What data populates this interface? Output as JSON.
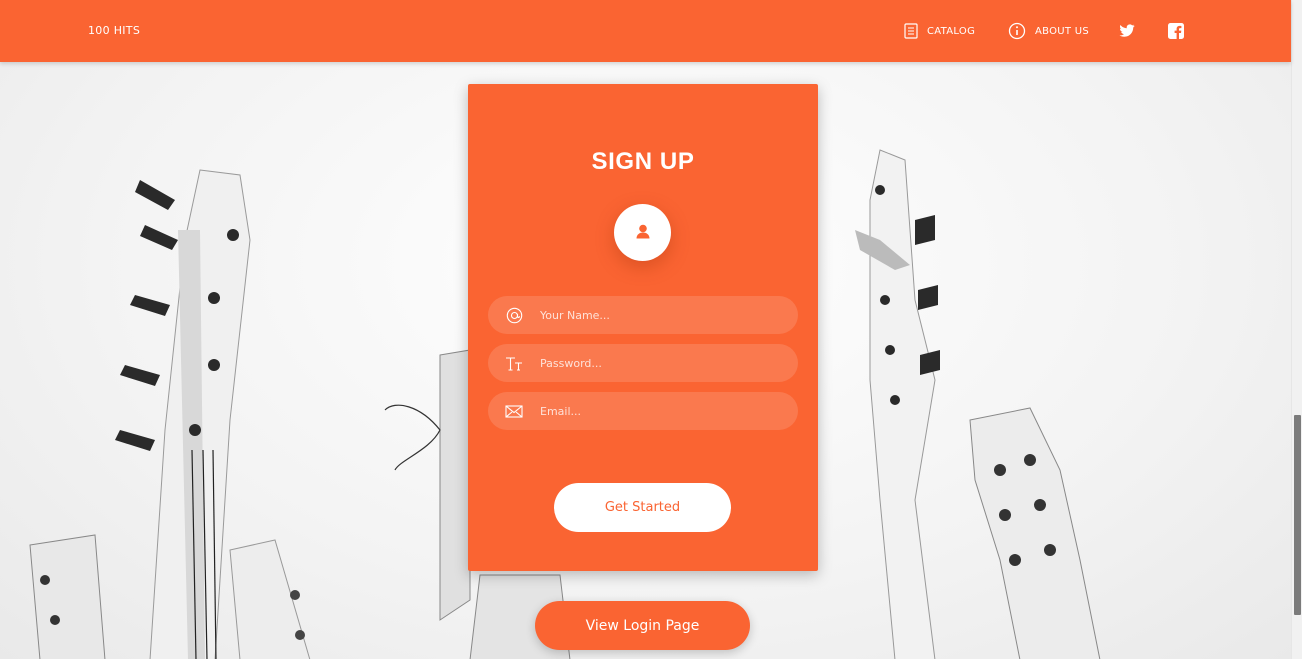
{
  "navbar": {
    "brand": "100 HITS",
    "items": [
      {
        "label": "CATALOG",
        "icon": "document-icon"
      },
      {
        "label": "ABOUT US",
        "icon": "info-icon"
      }
    ],
    "social": [
      {
        "icon": "twitter-icon"
      },
      {
        "icon": "facebook-icon"
      }
    ]
  },
  "card": {
    "title": "SIGN UP",
    "avatar_icon": "user-icon",
    "fields": {
      "name_placeholder": "Your Name...",
      "password_placeholder": "Password...",
      "email_placeholder": "Email..."
    },
    "submit_label": "Get Started"
  },
  "login_button_label": "View Login Page",
  "colors": {
    "accent": "#fa6432",
    "white": "#ffffff"
  }
}
